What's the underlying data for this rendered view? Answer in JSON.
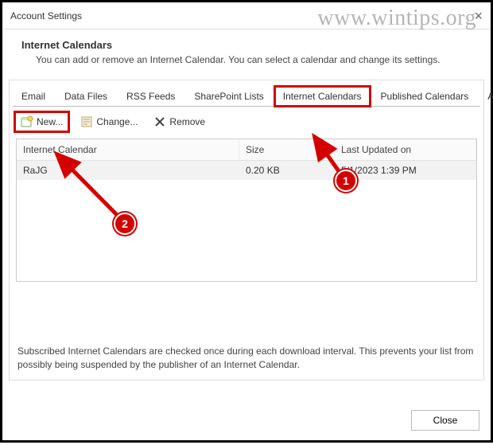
{
  "window": {
    "title": "Account Settings",
    "close": "×",
    "watermark": "www.wintips.org"
  },
  "header": {
    "title": "Internet Calendars",
    "description": "You can add or remove an Internet Calendar. You can select a calendar and change its settings."
  },
  "tabs": [
    {
      "label": "Email"
    },
    {
      "label": "Data Files"
    },
    {
      "label": "RSS Feeds"
    },
    {
      "label": "SharePoint Lists"
    },
    {
      "label": "Internet Calendars",
      "selected": true,
      "highlighted": true
    },
    {
      "label": "Published Calendars"
    },
    {
      "label": "Address Books"
    }
  ],
  "toolbar": {
    "new_label": "New...",
    "change_label": "Change...",
    "remove_label": "Remove"
  },
  "list": {
    "columns": {
      "name": "Internet Calendar",
      "size": "Size",
      "updated": "Last Updated on"
    },
    "rows": [
      {
        "name": "RaJG",
        "size": "0.20 KB",
        "updated": "5/1/2023 1:39 PM"
      }
    ]
  },
  "footnote": "Subscribed Internet Calendars are checked once during each download interval. This prevents your list from possibly being suspended by the publisher of an Internet Calendar.",
  "buttons": {
    "close": "Close"
  },
  "annotations": {
    "badge1": "1",
    "badge2": "2"
  }
}
